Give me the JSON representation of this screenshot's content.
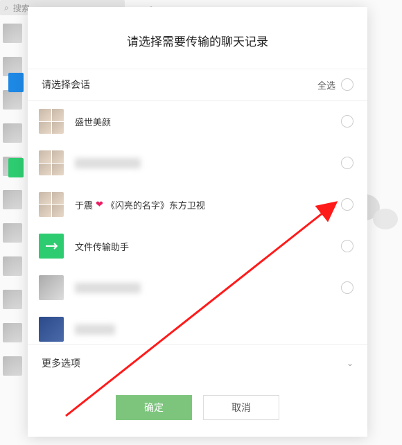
{
  "search": {
    "placeholder": "搜索"
  },
  "modal": {
    "title": "请选择需要传输的聊天记录",
    "section_label": "请选择会话",
    "select_all_label": "全选",
    "more_options_label": "更多选项",
    "confirm_label": "确定",
    "cancel_label": "取消"
  },
  "chats": [
    {
      "name": "盛世美颜",
      "avatar_type": "grid"
    },
    {
      "name": "██████",
      "avatar_type": "grid",
      "blurred": true
    },
    {
      "name_pre": "于震",
      "heart": "❤",
      "name_post": "《闪亮的名字》东方卫视",
      "avatar_type": "grid"
    },
    {
      "name": "文件传输助手",
      "avatar_type": "green"
    },
    {
      "name": "██████",
      "avatar_type": "single",
      "blurred": true
    },
    {
      "name": "██",
      "avatar_type": "single",
      "blurred": true
    }
  ]
}
